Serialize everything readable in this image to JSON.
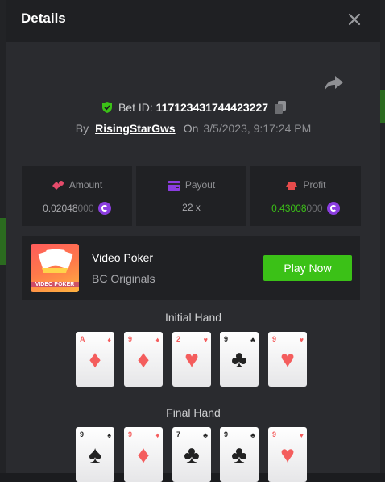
{
  "modal": {
    "title": "Details",
    "bet_id_label": "Bet ID:",
    "bet_id": "117123431744423227",
    "by_label": "By",
    "user": "RisingStarGws",
    "on_label": "On",
    "date": "3/5/2023, 9:17:24 PM"
  },
  "stats": {
    "amount": {
      "label": "Amount",
      "value_main": "0.02048",
      "value_dim": "000"
    },
    "payout": {
      "label": "Payout",
      "value": "22 x"
    },
    "profit": {
      "label": "Profit",
      "value_main": "0.43008",
      "value_dim": "000"
    }
  },
  "game": {
    "name": "Video Poker",
    "provider": "BC Originals",
    "thumb_text": "VIDEO POKER",
    "play_label": "Play Now"
  },
  "initial_hand": {
    "title": "Initial Hand",
    "cards": [
      {
        "rank": "A",
        "suit": "♦",
        "color": "red"
      },
      {
        "rank": "9",
        "suit": "♦",
        "color": "red"
      },
      {
        "rank": "2",
        "suit": "♥",
        "color": "red"
      },
      {
        "rank": "9",
        "suit": "♣",
        "color": "black"
      },
      {
        "rank": "9",
        "suit": "♥",
        "color": "red"
      }
    ]
  },
  "final_hand": {
    "title": "Final Hand",
    "cards": [
      {
        "rank": "9",
        "suit": "♠",
        "color": "black"
      },
      {
        "rank": "9",
        "suit": "♦",
        "color": "red"
      },
      {
        "rank": "7",
        "suit": "♣",
        "color": "black"
      },
      {
        "rank": "9",
        "suit": "♣",
        "color": "black"
      },
      {
        "rank": "9",
        "suit": "♥",
        "color": "red"
      }
    ]
  },
  "colors": {
    "accent_green": "#3bc117",
    "profit_green": "#3bc117",
    "coin_purple": "#8b3de0"
  }
}
